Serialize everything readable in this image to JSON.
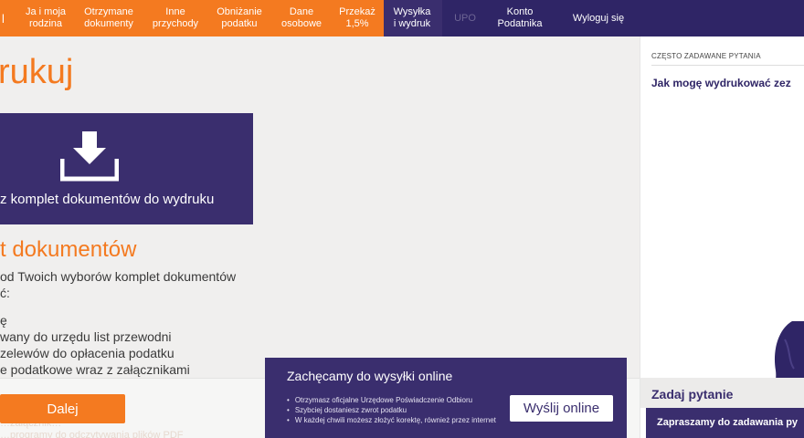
{
  "nav": {
    "first": "l",
    "items": [
      "Ja i moja\nrodzina",
      "Otrzymane\ndokumenty",
      "Inne\nprzychody",
      "Obniżanie\npodatku",
      "Dane\nosobowe",
      "Przekaż\n1,5%",
      "Wysyłka\ni wydruk",
      "UPO",
      "Konto\nPodatnika",
      "Wyloguj się"
    ]
  },
  "main": {
    "title": "rukuj",
    "download_label": "z komplet dokumentów do wydruku",
    "section_title": "t dokumentów",
    "intro": [
      "od Twoich wyborów komplet dokumentów",
      "ć:"
    ],
    "list": [
      "ę",
      "wany do urzędu list przewodni",
      "zelewów do opłacenia podatku",
      "e podatkowe wraz z załącznikami"
    ],
    "next_button": "Dalej",
    "faded": [
      "…załącznik…",
      "…programy do odczytywania plików PDF"
    ]
  },
  "promo": {
    "title": "Zachęcamy do wysyłki online",
    "points": [
      "Otrzymasz oficjalne Urzędowe Poświadczenie Odbioru",
      "Szybciej dostaniesz zwrot podatku",
      "W każdej chwili możesz złożyć korektę, również przez internet"
    ],
    "button": "Wyślij online"
  },
  "sidebar": {
    "faq_label": "CZĘSTO ZADAWANE PYTANIA",
    "faq_question": "Jak mogę wydrukować zez",
    "ask_title": "Zadaj pytanie",
    "ask_sub": "Zapraszamy do zadawania py"
  },
  "colors": {
    "orange": "#f47a20",
    "purple": "#3a2e6e",
    "dark_purple": "#2f2566"
  },
  "icons": {
    "download": "download-tray-icon"
  }
}
